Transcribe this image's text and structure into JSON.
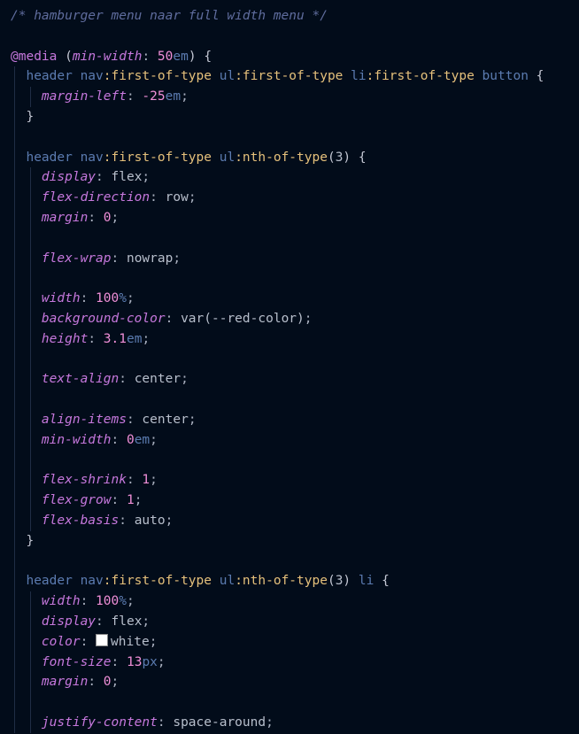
{
  "editor": {
    "lines": [
      [
        {
          "t": "comment",
          "v": "/* hamburger menu naar full width menu */"
        }
      ],
      [],
      [
        {
          "t": "atrule",
          "v": "@media"
        },
        {
          "t": "paren",
          "v": " ("
        },
        {
          "t": "param",
          "v": "min-width"
        },
        {
          "t": "punct",
          "v": ": "
        },
        {
          "t": "num",
          "v": "50"
        },
        {
          "t": "unit",
          "v": "em"
        },
        {
          "t": "paren",
          "v": ") "
        },
        {
          "t": "brace",
          "v": "{"
        }
      ],
      [
        {
          "t": "tag",
          "v": "  header nav"
        },
        {
          "t": "pseudo",
          "v": ":first-of-type"
        },
        {
          "t": "tag",
          "v": " ul"
        },
        {
          "t": "pseudo",
          "v": ":first-of-type"
        },
        {
          "t": "tag",
          "v": " li"
        },
        {
          "t": "pseudo",
          "v": ":first-of-type"
        },
        {
          "t": "tag",
          "v": " button "
        },
        {
          "t": "brace",
          "v": "{"
        }
      ],
      [
        {
          "t": "prop",
          "v": "    margin-left"
        },
        {
          "t": "punct",
          "v": ": "
        },
        {
          "t": "num",
          "v": "-25"
        },
        {
          "t": "unit",
          "v": "em"
        },
        {
          "t": "punct",
          "v": ";"
        }
      ],
      [
        {
          "t": "brace",
          "v": "  }"
        }
      ],
      [],
      [
        {
          "t": "tag",
          "v": "  header nav"
        },
        {
          "t": "pseudo",
          "v": ":first-of-type"
        },
        {
          "t": "tag",
          "v": " ul"
        },
        {
          "t": "pseudo",
          "v": ":nth-of-type"
        },
        {
          "t": "paren",
          "v": "("
        },
        {
          "t": "value",
          "v": "3"
        },
        {
          "t": "paren",
          "v": ") "
        },
        {
          "t": "brace",
          "v": "{"
        }
      ],
      [
        {
          "t": "prop",
          "v": "    display"
        },
        {
          "t": "punct",
          "v": ": "
        },
        {
          "t": "value",
          "v": "flex"
        },
        {
          "t": "punct",
          "v": ";"
        }
      ],
      [
        {
          "t": "prop",
          "v": "    flex-direction"
        },
        {
          "t": "punct",
          "v": ": "
        },
        {
          "t": "value",
          "v": "row"
        },
        {
          "t": "punct",
          "v": ";"
        }
      ],
      [
        {
          "t": "prop",
          "v": "    margin"
        },
        {
          "t": "punct",
          "v": ": "
        },
        {
          "t": "num",
          "v": "0"
        },
        {
          "t": "punct",
          "v": ";"
        }
      ],
      [],
      [
        {
          "t": "prop",
          "v": "    flex-wrap"
        },
        {
          "t": "punct",
          "v": ": "
        },
        {
          "t": "value",
          "v": "nowrap"
        },
        {
          "t": "punct",
          "v": ";"
        }
      ],
      [],
      [
        {
          "t": "prop",
          "v": "    width"
        },
        {
          "t": "punct",
          "v": ": "
        },
        {
          "t": "num",
          "v": "100"
        },
        {
          "t": "unit",
          "v": "%"
        },
        {
          "t": "punct",
          "v": ";"
        }
      ],
      [
        {
          "t": "prop",
          "v": "    background-color"
        },
        {
          "t": "punct",
          "v": ": "
        },
        {
          "t": "value",
          "v": "var(--red-color)"
        },
        {
          "t": "punct",
          "v": ";"
        }
      ],
      [
        {
          "t": "prop",
          "v": "    height"
        },
        {
          "t": "punct",
          "v": ": "
        },
        {
          "t": "num",
          "v": "3.1"
        },
        {
          "t": "unit",
          "v": "em"
        },
        {
          "t": "punct",
          "v": ";"
        }
      ],
      [],
      [
        {
          "t": "prop",
          "v": "    text-align"
        },
        {
          "t": "punct",
          "v": ": "
        },
        {
          "t": "value",
          "v": "center"
        },
        {
          "t": "punct",
          "v": ";"
        }
      ],
      [],
      [
        {
          "t": "prop",
          "v": "    align-items"
        },
        {
          "t": "punct",
          "v": ": "
        },
        {
          "t": "value",
          "v": "center"
        },
        {
          "t": "punct",
          "v": ";"
        }
      ],
      [
        {
          "t": "prop",
          "v": "    min-width"
        },
        {
          "t": "punct",
          "v": ": "
        },
        {
          "t": "num",
          "v": "0"
        },
        {
          "t": "unit",
          "v": "em"
        },
        {
          "t": "punct",
          "v": ";"
        }
      ],
      [],
      [
        {
          "t": "prop",
          "v": "    flex-shrink"
        },
        {
          "t": "punct",
          "v": ": "
        },
        {
          "t": "num",
          "v": "1"
        },
        {
          "t": "punct",
          "v": ";"
        }
      ],
      [
        {
          "t": "prop",
          "v": "    flex-grow"
        },
        {
          "t": "punct",
          "v": ": "
        },
        {
          "t": "num",
          "v": "1"
        },
        {
          "t": "punct",
          "v": ";"
        }
      ],
      [
        {
          "t": "prop",
          "v": "    flex-basis"
        },
        {
          "t": "punct",
          "v": ": "
        },
        {
          "t": "value",
          "v": "auto"
        },
        {
          "t": "punct",
          "v": ";"
        }
      ],
      [
        {
          "t": "brace",
          "v": "  }"
        }
      ],
      [],
      [
        {
          "t": "tag",
          "v": "  header nav"
        },
        {
          "t": "pseudo",
          "v": ":first-of-type"
        },
        {
          "t": "tag",
          "v": " ul"
        },
        {
          "t": "pseudo",
          "v": ":nth-of-type"
        },
        {
          "t": "paren",
          "v": "("
        },
        {
          "t": "value",
          "v": "3"
        },
        {
          "t": "paren",
          "v": ")"
        },
        {
          "t": "tag",
          "v": " li "
        },
        {
          "t": "brace",
          "v": "{"
        }
      ],
      [
        {
          "t": "prop",
          "v": "    width"
        },
        {
          "t": "punct",
          "v": ": "
        },
        {
          "t": "num",
          "v": "100"
        },
        {
          "t": "unit",
          "v": "%"
        },
        {
          "t": "punct",
          "v": ";"
        }
      ],
      [
        {
          "t": "prop",
          "v": "    display"
        },
        {
          "t": "punct",
          "v": ": "
        },
        {
          "t": "value",
          "v": "flex"
        },
        {
          "t": "punct",
          "v": ";"
        }
      ],
      [
        {
          "t": "prop",
          "v": "    color"
        },
        {
          "t": "punct",
          "v": ": "
        },
        {
          "t": "swatch",
          "v": "#ffffff"
        },
        {
          "t": "value",
          "v": "white"
        },
        {
          "t": "punct",
          "v": ";"
        }
      ],
      [
        {
          "t": "prop",
          "v": "    font-size"
        },
        {
          "t": "punct",
          "v": ": "
        },
        {
          "t": "num",
          "v": "13"
        },
        {
          "t": "unit",
          "v": "px"
        },
        {
          "t": "punct",
          "v": ";"
        }
      ],
      [
        {
          "t": "prop",
          "v": "    margin"
        },
        {
          "t": "punct",
          "v": ": "
        },
        {
          "t": "num",
          "v": "0"
        },
        {
          "t": "punct",
          "v": ";"
        }
      ],
      [],
      [
        {
          "t": "prop",
          "v": "    justify-content"
        },
        {
          "t": "punct",
          "v": ": "
        },
        {
          "t": "value",
          "v": "space-around"
        },
        {
          "t": "punct",
          "v": ";"
        }
      ]
    ]
  },
  "colors": {
    "background": "#020c1a",
    "comment": "#5f6c9d",
    "keyword": "#c678dd",
    "selector": "#5b7bb0",
    "pseudo": "#e5c07b",
    "number": "#f08fd8",
    "text": "#c4c8d4",
    "white_swatch": "#ffffff"
  }
}
